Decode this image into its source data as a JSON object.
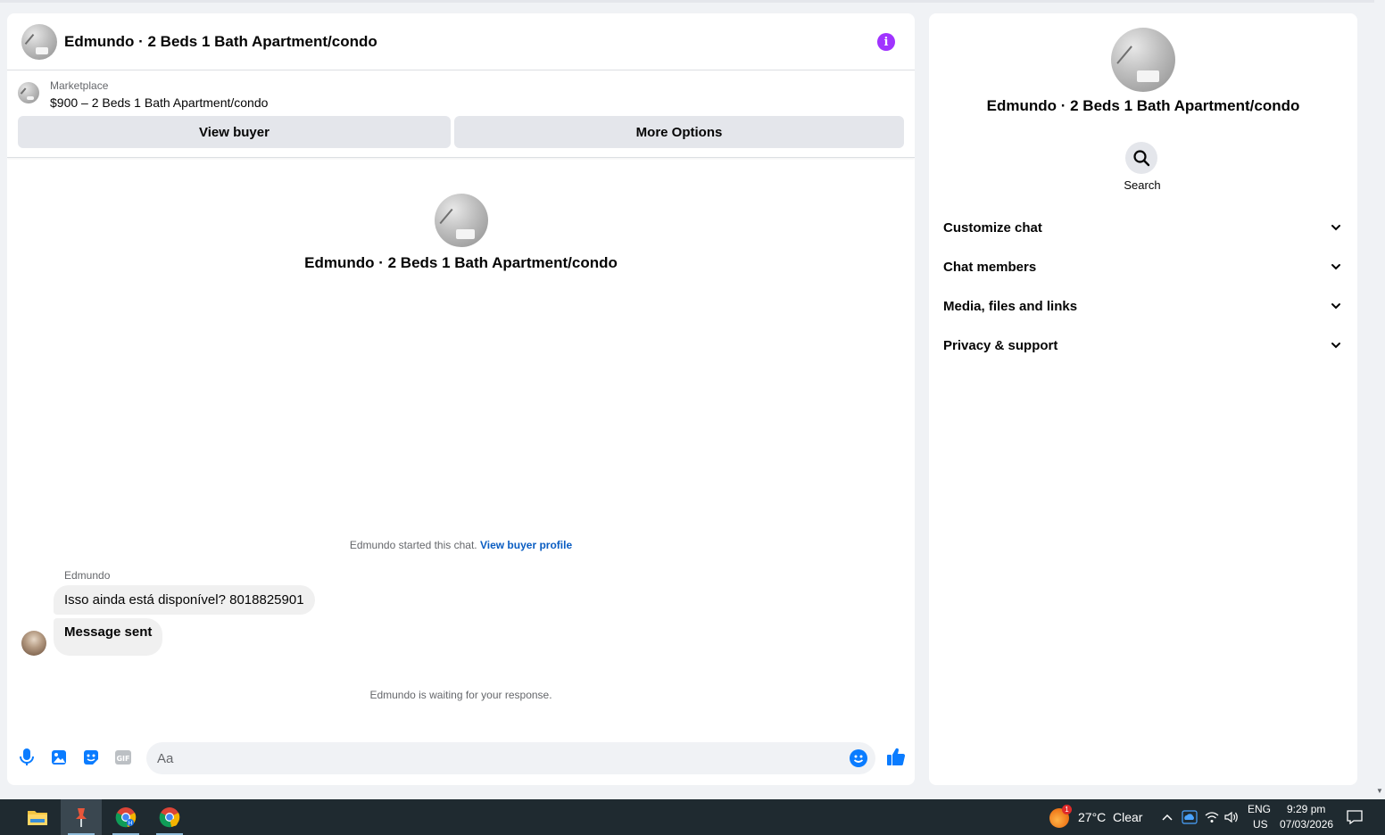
{
  "chat": {
    "title": "Edmundo · 2 Beds 1 Bath Apartment/condo",
    "listing": {
      "caption": "Marketplace",
      "name": "$900 – 2 Beds 1 Bath Apartment/condo"
    },
    "buttons": {
      "view_buyer": "View buyer",
      "more_options": "More Options"
    },
    "profile_name": "Edmundo · 2 Beds 1 Bath Apartment/condo",
    "started_text": "Edmundo started this chat.",
    "started_link": "View buyer profile",
    "sender": "Edmundo",
    "messages": [
      {
        "text": "Isso ainda está disponível? 8018825901"
      },
      {
        "text": "Message sent"
      }
    ],
    "waiting_text": "Edmundo is waiting for your response.",
    "composer": {
      "placeholder": "Aa"
    }
  },
  "details": {
    "name": "Edmundo · 2 Beds 1 Bath Apartment/condo",
    "search_label": "Search",
    "sections": [
      {
        "label": "Customize chat"
      },
      {
        "label": "Chat members"
      },
      {
        "label": "Media, files and links"
      },
      {
        "label": "Privacy & support"
      }
    ]
  },
  "taskbar": {
    "weather": {
      "temp": "27°C",
      "condition": "Clear",
      "badge": "1"
    },
    "lang": "ENG",
    "region": "US",
    "time": "9:29 pm",
    "date": "07/03/2026"
  },
  "colors": {
    "accent": "#0a7cff",
    "info_purple": "#a033ff",
    "link_blue": "#0a5dc2",
    "taskbar": "#1f2a30"
  },
  "icons": {
    "info": "info-icon",
    "search": "search-icon",
    "chevron": "chevron-down-icon",
    "mic": "microphone-icon",
    "image": "image-icon",
    "sticker": "sticker-icon",
    "gif": "gif-icon",
    "emoji": "emoji-icon",
    "like": "thumbs-up-icon"
  }
}
